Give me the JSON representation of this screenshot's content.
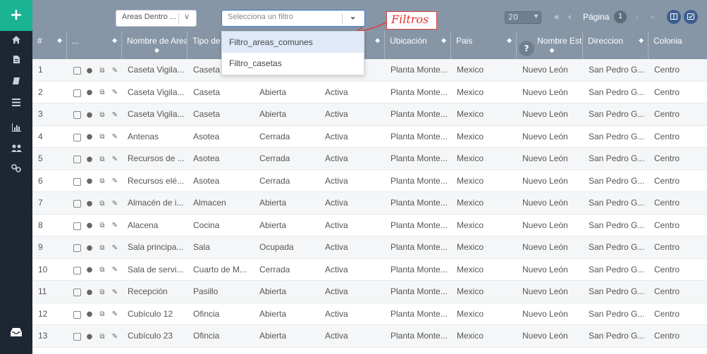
{
  "sidebar": {
    "add_label": "+",
    "icons": [
      "home-icon",
      "file-icon",
      "book-icon",
      "list-icon",
      "bar-chart-icon",
      "users-icon",
      "link-icon"
    ],
    "bottom_icon": "inbox-icon"
  },
  "toolbar": {
    "areas_select": {
      "value": "Areas Dentro ...",
      "chevron": "∨"
    },
    "filter_select": {
      "placeholder": "Selecciona un filtro",
      "chevron": "⌄"
    },
    "annotation": "Filtros",
    "page_size": "20",
    "nav_first": "«",
    "nav_prev": "‹",
    "page_label": "Página",
    "page_number": "1",
    "nav_next": "›",
    "nav_last": "»",
    "accent": "#3c5f8e"
  },
  "filter_menu": {
    "options": [
      "Filtro_areas_comunes",
      "Filtro_casetas"
    ],
    "highlighted_index": 0
  },
  "table": {
    "headers": [
      "#",
      "...",
      "Nombre de Area",
      "Tipo de",
      "",
      "",
      "Ubicación",
      "Pais",
      "Nombre Estado",
      "Direccion",
      "Colonia"
    ],
    "rows": [
      [
        "1",
        "Caseta Vigila...",
        "Caseta",
        "",
        "",
        "Planta Monte...",
        "Mexico",
        "Nuevo León",
        "San Pedro G...",
        "Centro"
      ],
      [
        "2",
        "Caseta Vigila...",
        "Caseta",
        "Abierta",
        "Activa",
        "Planta Monte...",
        "Mexico",
        "Nuevo León",
        "San Pedro G...",
        "Centro"
      ],
      [
        "3",
        "Caseta Vigila...",
        "Caseta",
        "Abierta",
        "Activa",
        "Planta Monte...",
        "Mexico",
        "Nuevo León",
        "San Pedro G...",
        "Centro"
      ],
      [
        "4",
        "Antenas",
        "Asotea",
        "Cerrada",
        "Activa",
        "Planta Monte...",
        "Mexico",
        "Nuevo León",
        "San Pedro G...",
        "Centro"
      ],
      [
        "5",
        "Recursos de ...",
        "Asotea",
        "Cerrada",
        "Activa",
        "Planta Monte...",
        "Mexico",
        "Nuevo León",
        "San Pedro G...",
        "Centro"
      ],
      [
        "6",
        "Recursos elé...",
        "Asotea",
        "Cerrada",
        "Activa",
        "Planta Monte...",
        "Mexico",
        "Nuevo León",
        "San Pedro G...",
        "Centro"
      ],
      [
        "7",
        "Almacén de i...",
        "Almacen",
        "Abierta",
        "Activa",
        "Planta Monte...",
        "Mexico",
        "Nuevo León",
        "San Pedro G...",
        "Centro"
      ],
      [
        "8",
        "Alacena",
        "Cocina",
        "Abierta",
        "Activa",
        "Planta Monte...",
        "Mexico",
        "Nuevo León",
        "San Pedro G...",
        "Centro"
      ],
      [
        "9",
        "Sala principa...",
        "Sala",
        "Ocupada",
        "Activa",
        "Planta Monte...",
        "Mexico",
        "Nuevo León",
        "San Pedro G...",
        "Centro"
      ],
      [
        "10",
        "Sala de servi...",
        "Cuarto de M...",
        "Cerrada",
        "Activa",
        "Planta Monte...",
        "Mexico",
        "Nuevo León",
        "San Pedro G...",
        "Centro"
      ],
      [
        "11",
        "Recepción",
        "Pasillo",
        "Abierta",
        "Activa",
        "Planta Monte...",
        "Mexico",
        "Nuevo León",
        "San Pedro G...",
        "Centro"
      ],
      [
        "12",
        "Cubículo 12",
        "Ofincia",
        "Abierta",
        "Activa",
        "Planta Monte...",
        "Mexico",
        "Nuevo León",
        "San Pedro G...",
        "Centro"
      ],
      [
        "13",
        "Cubículo 23",
        "Ofincia",
        "Abierta",
        "Activa",
        "Planta Monte...",
        "Mexico",
        "Nuevo León",
        "San Pedro G...",
        "Centro"
      ]
    ]
  }
}
